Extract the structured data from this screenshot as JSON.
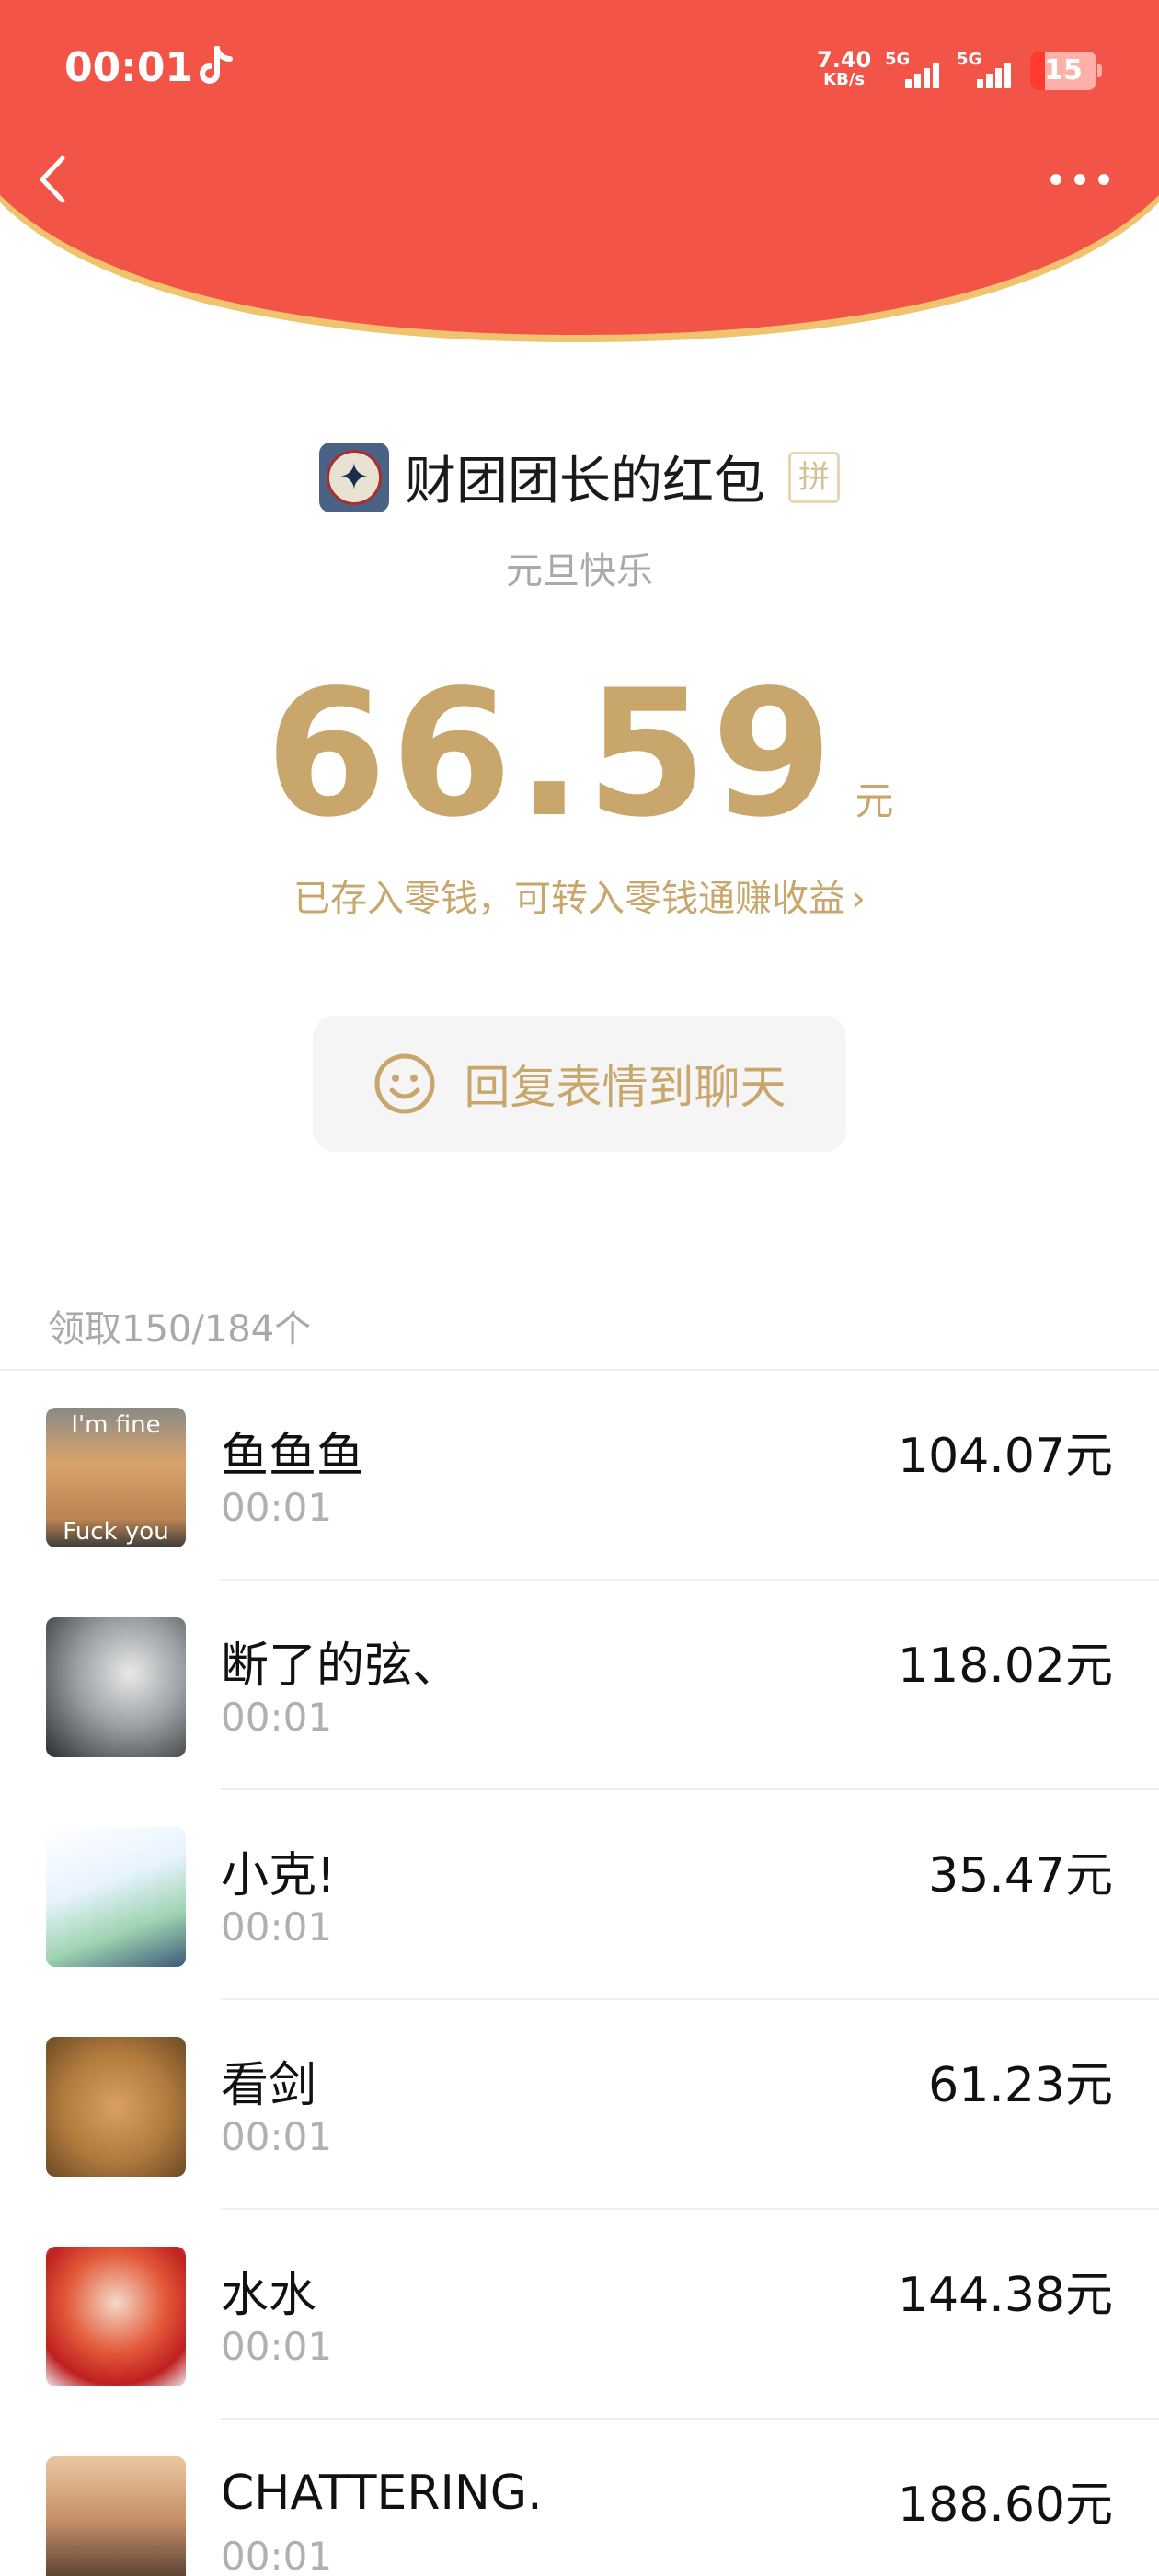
{
  "status_bar": {
    "time": "00:01",
    "net_speed": "7.40",
    "net_unit": "KB/s",
    "sim1": "5G",
    "sim2": "5G",
    "battery": "15"
  },
  "envelope": {
    "sender_title": "财团团长的红包",
    "pin_badge": "拼",
    "greeting": "元旦快乐",
    "amount": "66.59",
    "currency": "元",
    "note": "已存入零钱，可转入零钱通赚收益",
    "note_chevron": "›",
    "reply_button": "回复表情到聊天"
  },
  "summary": {
    "received": "领取150/184个"
  },
  "recipients": [
    {
      "name": "鱼鱼鱼",
      "time": "00:01",
      "amount": "104.07元",
      "avatar_text_top": "I'm fine",
      "avatar_text_bottom": "Fuck you"
    },
    {
      "name": "断了的弦、",
      "time": "00:01",
      "amount": "118.02元"
    },
    {
      "name": "小克!",
      "time": "00:01",
      "amount": "35.47元"
    },
    {
      "name": "看剑",
      "time": "00:01",
      "amount": "61.23元"
    },
    {
      "name": "水水",
      "time": "00:01",
      "amount": "144.38元"
    },
    {
      "name": "CHATTERING.",
      "time": "00:01",
      "amount": "188.60元"
    }
  ],
  "colors": {
    "header_red": "#f25548",
    "gold": "#c9a66b",
    "gray_text": "#a9a9a9"
  }
}
